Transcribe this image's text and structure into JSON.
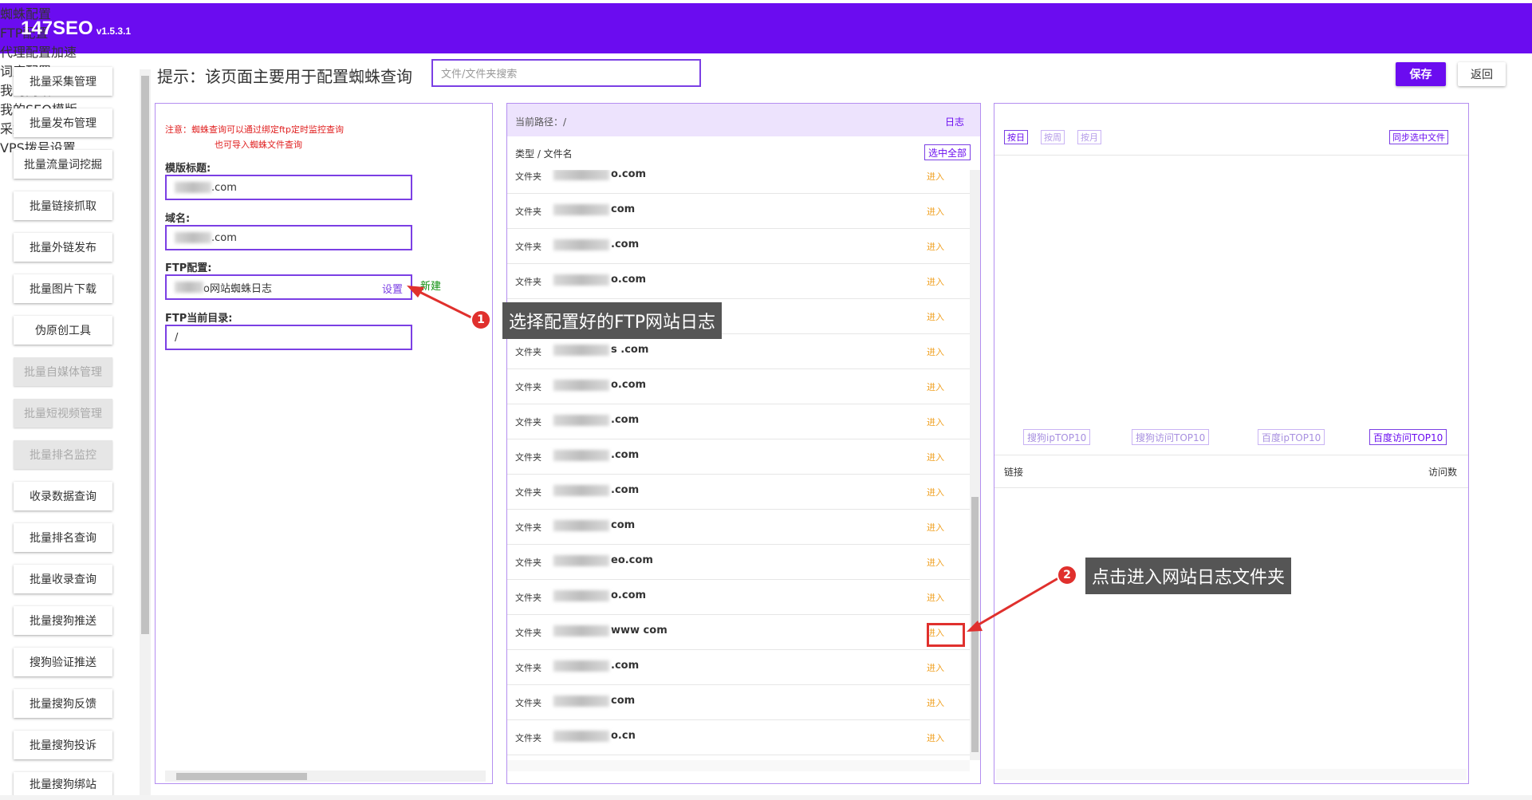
{
  "app": {
    "name": "147SEO",
    "version": "v1.5.3.1"
  },
  "topnav": [
    {
      "label": "蜘蛛配置"
    },
    {
      "label": "FTP配置"
    },
    {
      "label": "代理配置加速"
    },
    {
      "label": "词库配置"
    },
    {
      "label": "我的网站"
    },
    {
      "label": "我的SEO模版"
    },
    {
      "label": "采集QQ群"
    },
    {
      "label": "VPS拨号设置"
    }
  ],
  "sidebar": [
    {
      "label": "批量采集管理",
      "disabled": false
    },
    {
      "label": "批量发布管理",
      "disabled": false
    },
    {
      "label": "批量流量词挖掘",
      "disabled": false
    },
    {
      "label": "批量链接抓取",
      "disabled": false
    },
    {
      "label": "批量外链发布",
      "disabled": false
    },
    {
      "label": "批量图片下载",
      "disabled": false
    },
    {
      "label": "伪原创工具",
      "disabled": false
    },
    {
      "label": "批量自媒体管理",
      "disabled": true
    },
    {
      "label": "批量短视频管理",
      "disabled": true
    },
    {
      "label": "批量排名监控",
      "disabled": true
    },
    {
      "label": "收录数据查询",
      "disabled": false
    },
    {
      "label": "批量排名查询",
      "disabled": false
    },
    {
      "label": "批量收录查询",
      "disabled": false
    },
    {
      "label": "批量搜狗推送",
      "disabled": false
    },
    {
      "label": "搜狗验证推送",
      "disabled": false
    },
    {
      "label": "批量搜狗反馈",
      "disabled": false
    },
    {
      "label": "批量搜狗投诉",
      "disabled": false
    },
    {
      "label": "批量搜狗绑站",
      "disabled": false
    }
  ],
  "hint": "提示：该页面主要用于配置蜘蛛查询",
  "search": {
    "placeholder": "文件/文件夹搜索"
  },
  "actions": {
    "save": "保存",
    "back": "返回"
  },
  "config": {
    "note_line1": "注意：蜘蛛查询可以通过绑定ftp定时监控查询",
    "note_line2": "也可导入蜘蛛文件查询",
    "template_title_label": "模版标题:",
    "template_title_value": ".com",
    "domain_label": "域名:",
    "domain_value": ".com",
    "ftp_label": "FTP配置:",
    "ftp_value": "o网站蜘蛛日志",
    "ftp_set": "设置",
    "ftp_new": "新建",
    "ftp_dir_label": "FTP当前目录:",
    "ftp_dir_value": "/"
  },
  "browser": {
    "path_label": "当前路径：/",
    "log_link": "日志",
    "column_header": "类型 / 文件名",
    "select_all": "选中全部",
    "rows": [
      {
        "type": "文件夹",
        "name": "o.com",
        "action": "进入"
      },
      {
        "type": "文件夹",
        "name": "com",
        "action": "进入"
      },
      {
        "type": "文件夹",
        "name": ".com",
        "action": "进入"
      },
      {
        "type": "文件夹",
        "name": "o.com",
        "action": "进入"
      },
      {
        "type": "文件夹",
        "name": "",
        "action": "进入"
      },
      {
        "type": "文件夹",
        "name": "s .com",
        "action": "进入"
      },
      {
        "type": "文件夹",
        "name": "o.com",
        "action": "进入"
      },
      {
        "type": "文件夹",
        "name": ".com",
        "action": "进入"
      },
      {
        "type": "文件夹",
        "name": ".com",
        "action": "进入"
      },
      {
        "type": "文件夹",
        "name": ".com",
        "action": "进入"
      },
      {
        "type": "文件夹",
        "name": "com",
        "action": "进入"
      },
      {
        "type": "文件夹",
        "name": "eo.com",
        "action": "进入"
      },
      {
        "type": "文件夹",
        "name": "o.com",
        "action": "进入"
      },
      {
        "type": "文件夹",
        "name": "www com",
        "action": "进入"
      },
      {
        "type": "文件夹",
        "name": ".com",
        "action": "进入"
      },
      {
        "type": "文件夹",
        "name": "com",
        "action": "进入"
      },
      {
        "type": "文件夹",
        "name": "o.cn",
        "action": "进入"
      }
    ]
  },
  "stats": {
    "by_day": "按日",
    "by_week": "按周",
    "by_month": "按月",
    "sync": "同步选中文件",
    "tabs": [
      "搜狗ipTOP10",
      "搜狗访问TOP10",
      "百度ipTOP10",
      "百度访问TOP10"
    ],
    "col_link": "链接",
    "col_visits": "访问数"
  },
  "annotations": [
    {
      "num": "1",
      "text": "选择配置好的FTP网站日志"
    },
    {
      "num": "2",
      "text": "点击进入网站日志文件夹"
    }
  ],
  "colors": {
    "accent": "#6b0cf0",
    "border": "#7b3fe4",
    "warning": "#e02020",
    "enter": "#f0a020",
    "annotation": "#e0302d"
  }
}
